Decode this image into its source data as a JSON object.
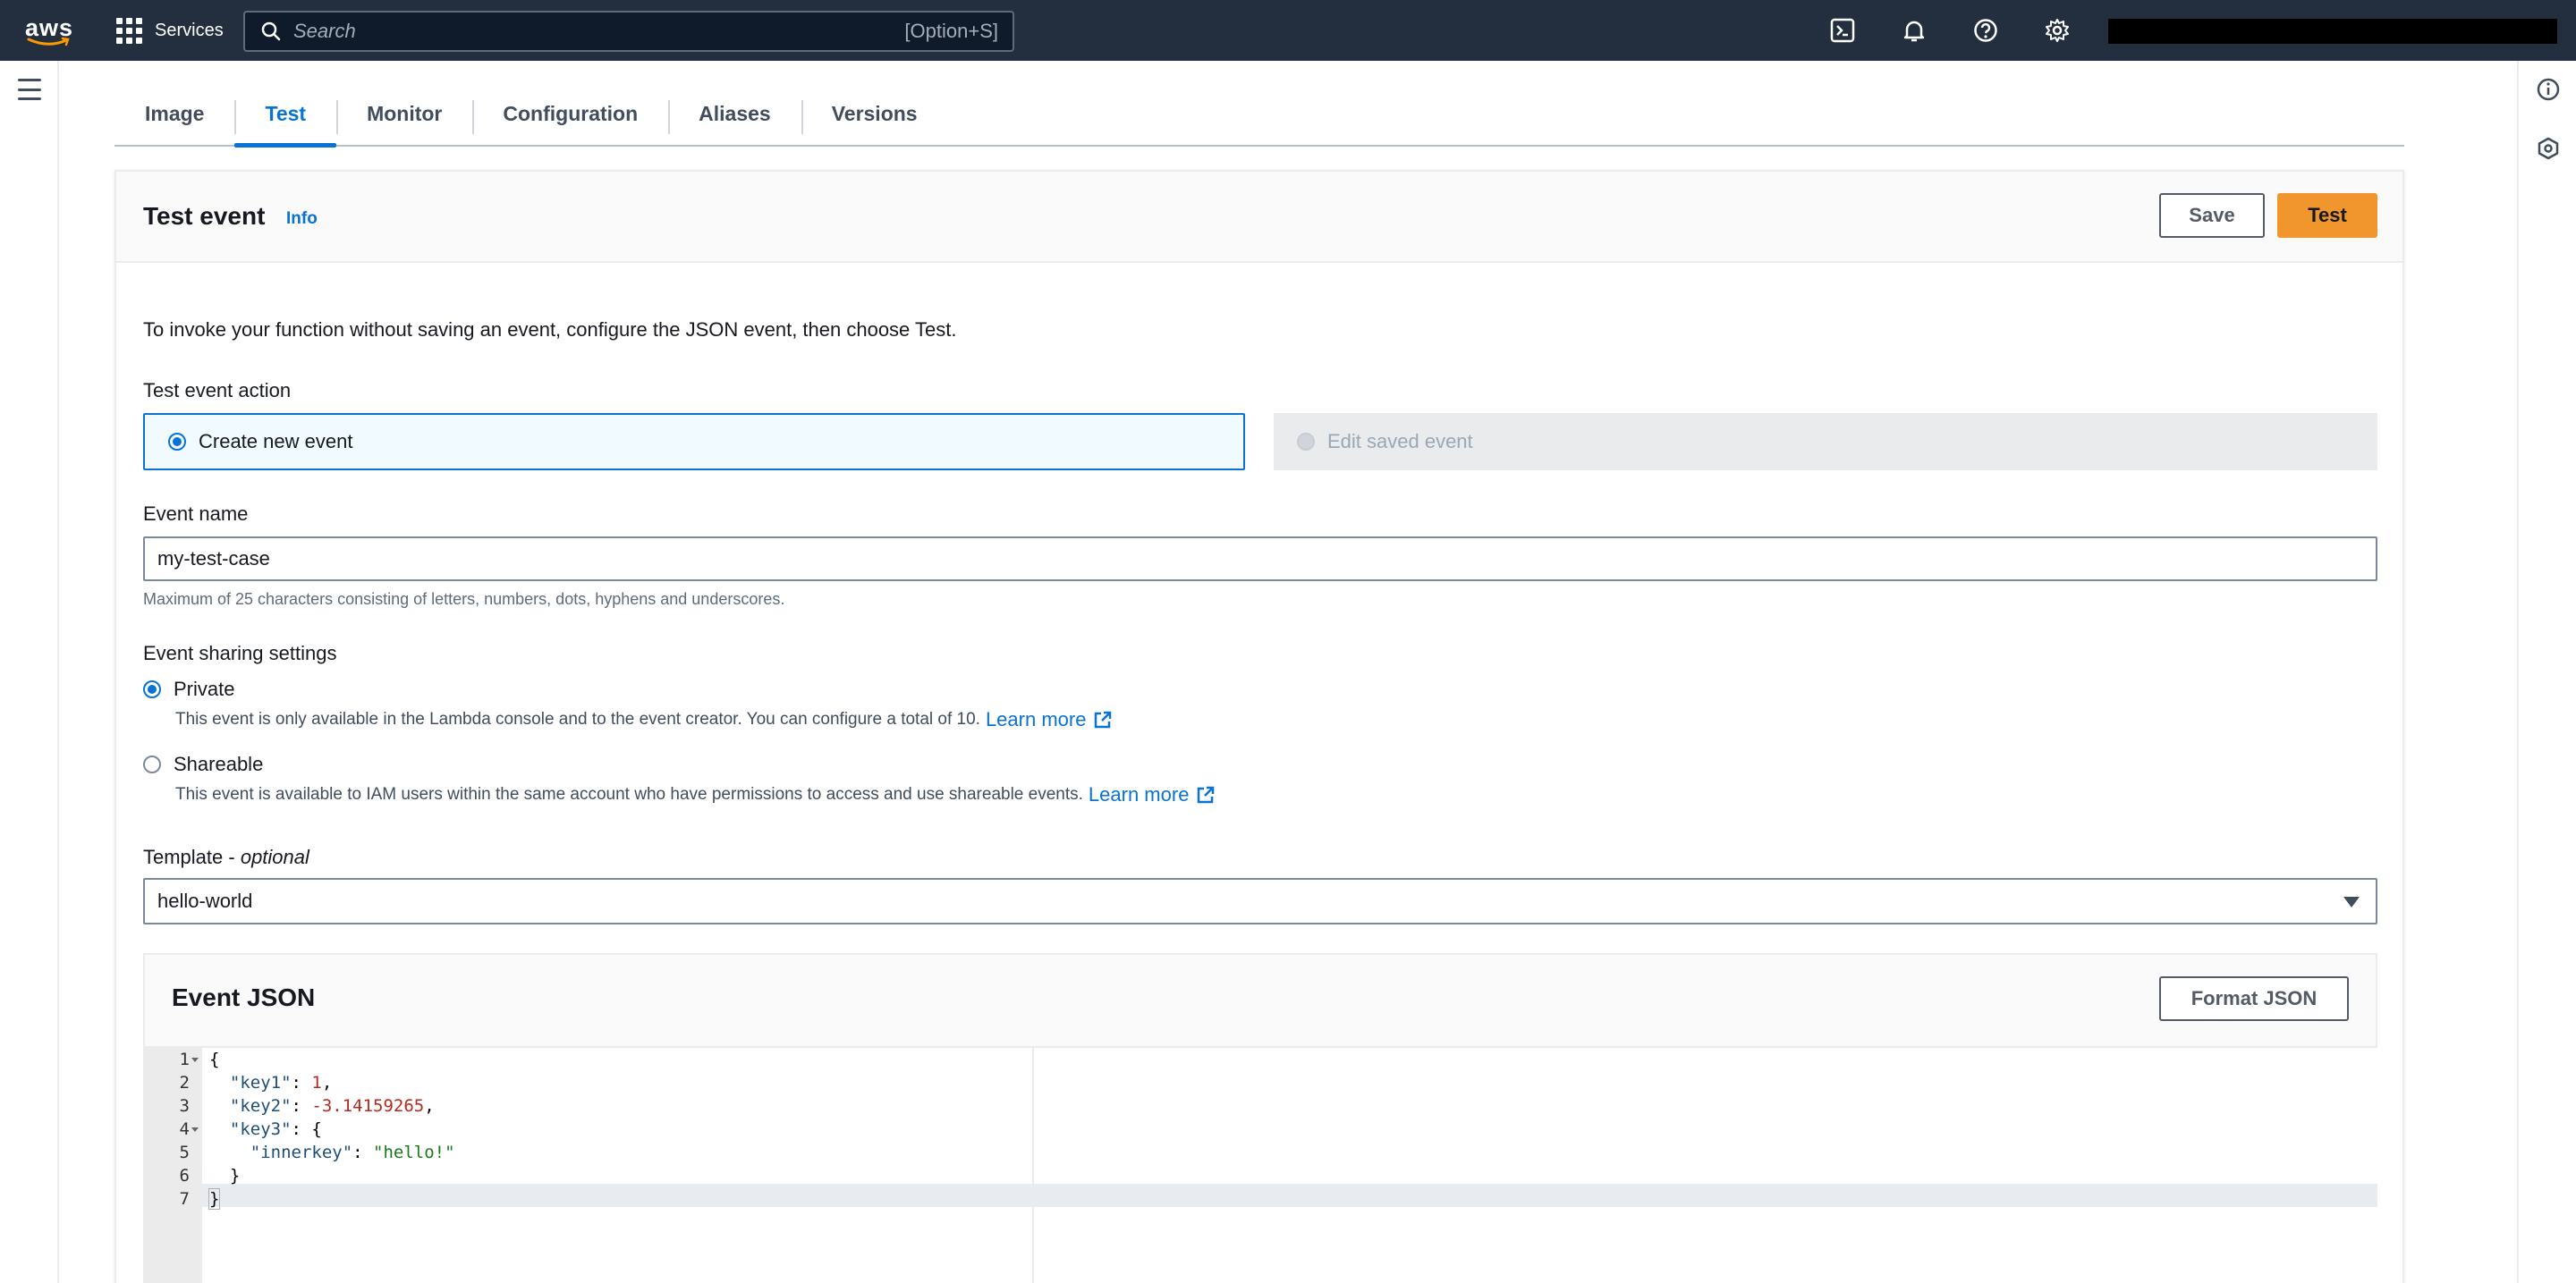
{
  "topnav": {
    "logo_text": "aws",
    "services_label": "Services",
    "search_placeholder": "Search",
    "search_shortcut": "[Option+S]",
    "icons": [
      "cloudshell-icon",
      "bell-icon",
      "help-icon",
      "gear-icon"
    ]
  },
  "tabs": [
    {
      "label": "Image",
      "active": false
    },
    {
      "label": "Test",
      "active": true
    },
    {
      "label": "Monitor",
      "active": false
    },
    {
      "label": "Configuration",
      "active": false
    },
    {
      "label": "Aliases",
      "active": false
    },
    {
      "label": "Versions",
      "active": false
    }
  ],
  "test_event": {
    "title": "Test event",
    "info_link": "Info",
    "save_label": "Save",
    "test_label": "Test",
    "intro": "To invoke your function without saving an event, configure the JSON event, then choose Test.",
    "action_label": "Test event action",
    "action_create": "Create new event",
    "action_edit": "Edit saved event",
    "event_name_label": "Event name",
    "event_name_value": "my-test-case",
    "event_name_hint": "Maximum of 25 characters consisting of letters, numbers, dots, hyphens and underscores.",
    "sharing_label": "Event sharing settings",
    "private_label": "Private",
    "private_desc": "This event is only available in the Lambda console and to the event creator. You can configure a total of 10.",
    "shareable_label": "Shareable",
    "shareable_desc": "This event is available to IAM users within the same account who have permissions to access and use shareable events.",
    "learn_more": "Learn more",
    "template_label": "Template - ",
    "template_optional": "optional",
    "template_value": "hello-world"
  },
  "event_json": {
    "title": "Event JSON",
    "format_label": "Format JSON",
    "line_numbers": [
      "1",
      "2",
      "3",
      "4",
      "5",
      "6",
      "7"
    ]
  },
  "colors": {
    "nav_bg": "#232f3e",
    "link": "#0972d3",
    "primary_button": "#f0962d"
  }
}
